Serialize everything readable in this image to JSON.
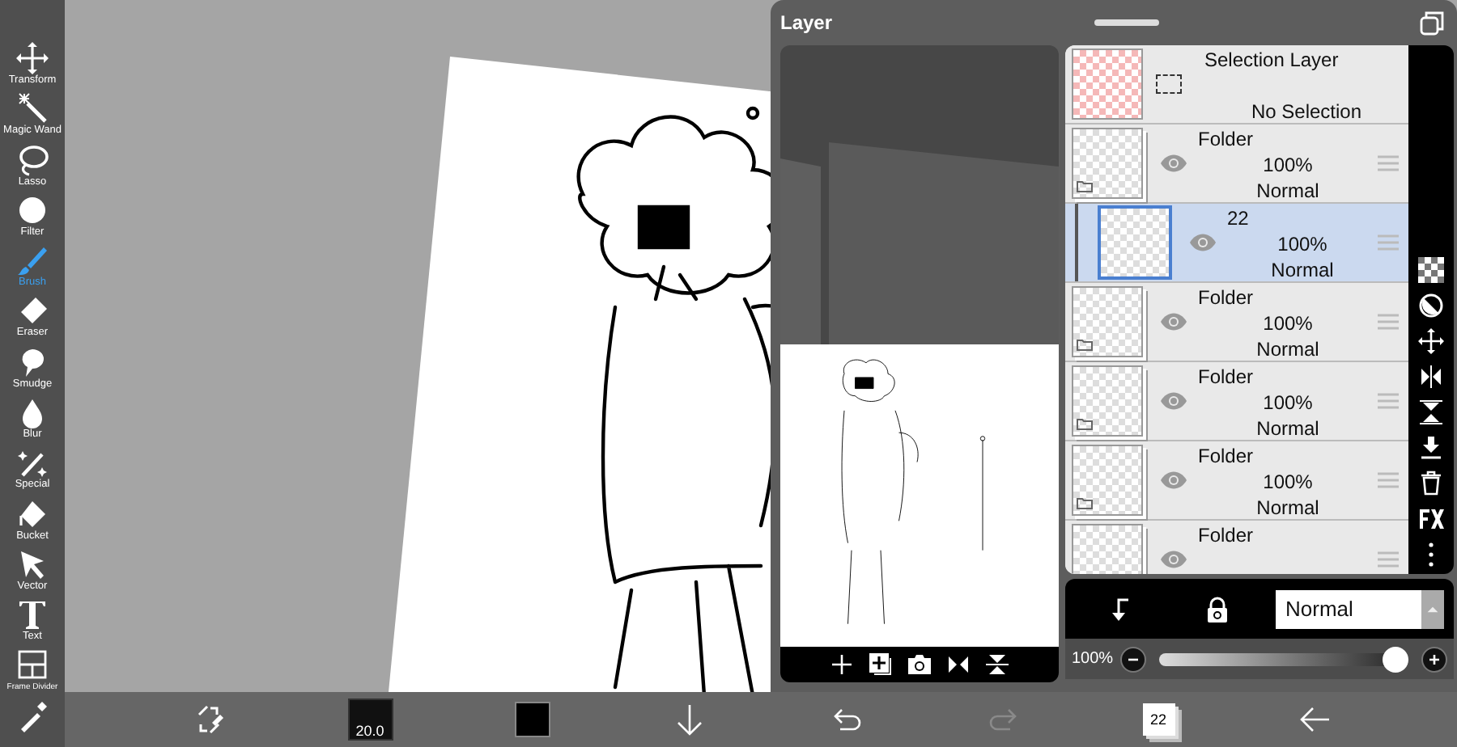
{
  "tools": [
    {
      "kind": "transform",
      "label": "Transform",
      "selected": false
    },
    {
      "kind": "wand",
      "label": "Magic Wand",
      "selected": false
    },
    {
      "kind": "lasso",
      "label": "Lasso",
      "selected": false
    },
    {
      "kind": "filter",
      "label": "Filter",
      "selected": false
    },
    {
      "kind": "brush",
      "label": "Brush",
      "selected": true
    },
    {
      "kind": "eraser",
      "label": "Eraser",
      "selected": false
    },
    {
      "kind": "smudge",
      "label": "Smudge",
      "selected": false
    },
    {
      "kind": "blur",
      "label": "Blur",
      "selected": false
    },
    {
      "kind": "special",
      "label": "Special",
      "selected": false
    },
    {
      "kind": "bucket",
      "label": "Bucket",
      "selected": false
    },
    {
      "kind": "vector",
      "label": "Vector",
      "selected": false
    },
    {
      "kind": "text",
      "label": "Text",
      "selected": false
    },
    {
      "kind": "frame",
      "label": "Frame Divider",
      "selected": false
    },
    {
      "kind": "dropper",
      "selected": false
    }
  ],
  "bottom_bar": {
    "brush_size": "20.0",
    "layer_count": "22",
    "redo_disabled": true
  },
  "layer_panel": {
    "title": "Layer",
    "layers": [
      {
        "kind": "selection",
        "name": "Selection Layer",
        "status": "No Selection"
      },
      {
        "kind": "folder",
        "name": "Folder",
        "opacity": "100%",
        "blend": "Normal",
        "selected": false,
        "children": [
          {
            "kind": "layer",
            "name": "22",
            "opacity": "100%",
            "blend": "Normal",
            "selected": true
          }
        ]
      },
      {
        "kind": "folder",
        "name": "Folder",
        "opacity": "100%",
        "blend": "Normal",
        "selected": false
      },
      {
        "kind": "folder",
        "name": "Folder",
        "opacity": "100%",
        "blend": "Normal",
        "selected": false
      },
      {
        "kind": "folder",
        "name": "Folder",
        "opacity": "100%",
        "blend": "Normal",
        "selected": false
      },
      {
        "kind": "folder",
        "name": "Folder",
        "selected": false
      }
    ],
    "blend_mode": "Normal",
    "opacity": {
      "reading": "100%",
      "level": 0.95
    }
  }
}
